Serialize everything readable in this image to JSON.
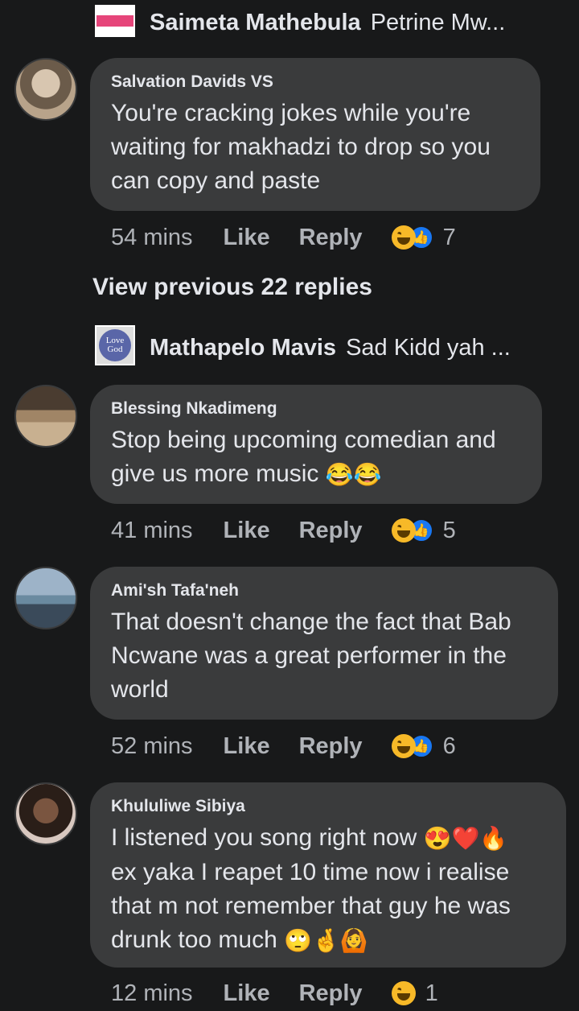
{
  "top_reply": {
    "name": "Saimeta Mathebula",
    "snippet": "Petrine Mw..."
  },
  "view_previous": "View previous 22 replies",
  "middle_reply": {
    "name": "Mathapelo Mavis",
    "snippet": "Sad Kidd yah ...",
    "avatar_text": "Love God"
  },
  "comments": [
    {
      "name": "Salvation Davids VS",
      "text": "You're cracking jokes while you're waiting for makhadzi to drop so you can copy and paste",
      "time": "54 mins",
      "like": "Like",
      "reply": "Reply",
      "reactions": "7"
    },
    {
      "name": "Blessing Nkadimeng",
      "text": "Stop being upcoming comedian and give us more music",
      "time": "41 mins",
      "like": "Like",
      "reply": "Reply",
      "reactions": "5"
    },
    {
      "name": "Ami'sh Tafa'neh",
      "text": "That doesn't change the fact that Bab Ncwane was a great performer in the world",
      "time": "52 mins",
      "like": "Like",
      "reply": "Reply",
      "reactions": "6"
    },
    {
      "name": "Khululiwe Sibiya",
      "text_line1": "I listened you song right now",
      "text_rest": "ex yaka I reapet 10 time now i realise that m not remember that guy he was drunk too much",
      "time": "12 mins",
      "like": "Like",
      "reply": "Reply",
      "reactions": "1"
    }
  ],
  "icons": {
    "reaction_haha": "haha-emoji-icon",
    "reaction_like": "like-thumb-icon"
  },
  "colors": {
    "background": "#18191a",
    "bubble": "#3a3b3c",
    "text": "#e4e6eb",
    "muted": "#b0b3b8",
    "like_blue": "#1877f2",
    "haha_yellow": "#f7b928"
  }
}
